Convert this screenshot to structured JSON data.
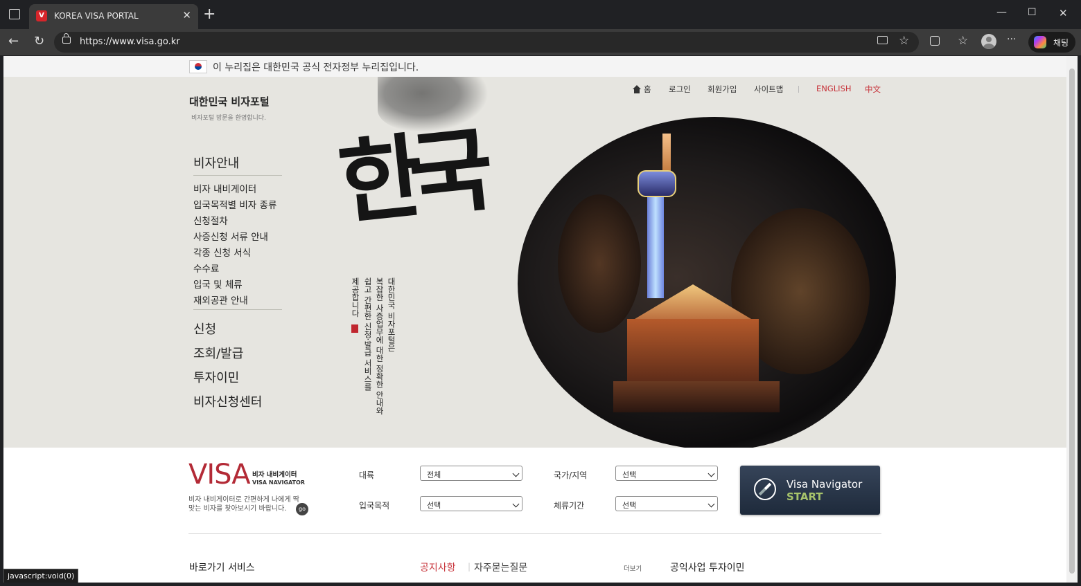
{
  "browser": {
    "tab_title": "KOREA VISA PORTAL",
    "favicon_text": "V",
    "close_glyph": "✕",
    "new_tab_glyph": "+",
    "url": "https://www.visa.go.kr",
    "chat_label": "채팅",
    "min_glyph": "—",
    "max_glyph": "☐",
    "close_win_glyph": "✕",
    "back_glyph": "←",
    "reload_glyph": "↻",
    "more_glyph": "···",
    "star_glyph": "☆",
    "fav_glyph": "☆"
  },
  "notice": {
    "text": "이 누리집은 대한민국 공식 전자정부 누리집입니다."
  },
  "header": {
    "site_title": "대한민국 비자포털",
    "site_subtitle": "비자포털 방문을 환영합니다.",
    "top_menu": {
      "home": "홈",
      "login": "로그인",
      "signup": "회원가입",
      "sitemap": "사이트맵",
      "english": "ENGLISH",
      "chinese": "中文"
    }
  },
  "nav": {
    "visa_guide": "비자안내",
    "sub_items": [
      "비자 내비게이터",
      "입국목적별 비자 종류",
      "신청절차",
      "사증신청 서류 안내",
      "각종 신청 서식",
      "수수료",
      "입국 및 체류",
      "재외공관 안내"
    ],
    "apply": "신청",
    "inquiry": "조회/발급",
    "investment": "투자이민",
    "center": "비자신청센터"
  },
  "hero": {
    "calligraphy": "한국",
    "vertical_text": [
      "대한민국 비자포털은",
      "복잡한 사증업무에 대한 정확한 안내와",
      "쉽고 간편한 신청·발급 서비스를",
      "제공합니다"
    ]
  },
  "navigator": {
    "brand": "VISA",
    "title_ko": "비자 내비게이터",
    "title_en": "VISA NAVIGATOR",
    "description": "비자 내비게이터로 간편하게 나에게 딱 맞는 비자를 찾아보시기 바랍니다.",
    "go_label": "go",
    "fields": [
      {
        "label": "대륙",
        "value": "전체"
      },
      {
        "label": "국가/지역",
        "value": "선택"
      },
      {
        "label": "입국목적",
        "value": "선택"
      },
      {
        "label": "체류기간",
        "value": "선택"
      }
    ],
    "start_line1": "Visa Navigator",
    "start_line2": "START"
  },
  "bottom": {
    "shortcuts": "바로가기 서비스",
    "notice_tab": "공지사항",
    "faq_tab": "자주묻는질문",
    "more": "더보기",
    "investment": "공익사업 투자이민"
  },
  "status_tooltip": "javascript:void(0)"
}
